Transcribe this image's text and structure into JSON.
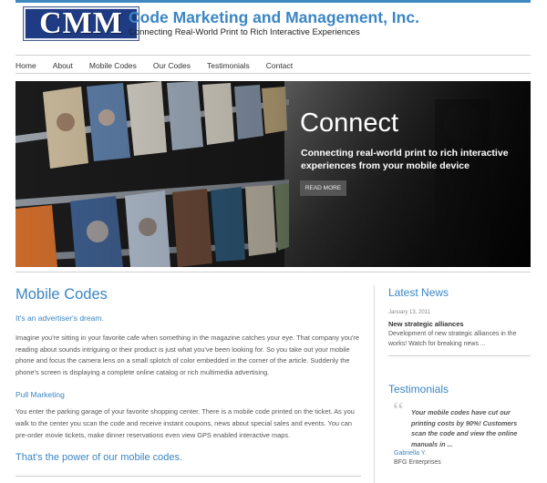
{
  "header": {
    "logo_text": "CMM",
    "title": "Code Marketing and Management, Inc.",
    "tagline": "Connecting Real-World Print to Rich Interactive Experiences"
  },
  "nav": {
    "items": [
      "Home",
      "About",
      "Mobile Codes",
      "Our Codes",
      "Testimonials",
      "Contact"
    ]
  },
  "slide": {
    "title": "Connect",
    "subtitle": "Connecting real-world print to rich interactive experiences from your mobile device",
    "button": "READ MORE"
  },
  "main": {
    "heading": "Mobile Codes",
    "lead": "It's an advertiser's dream.",
    "para1": "Imagine you're sitting in your favorite cafe when something in the magazine catches your eye. That company you're reading about sounds intriguing or their product is just what you've been looking for. So you take out your mobile phone and focus the camera lens on a small splotch of color embedded in the corner of the article. Suddenly the phone's screen is displaying a complete online catalog or rich multimedia advertising.",
    "subheading": "Pull Marketing",
    "para2": "You enter the parking garage of your favorite shopping center. There is a mobile code printed on the ticket. As you walk to the center you scan the code and receive instant coupons, news about special sales and events. You can pre-order movie tickets, make dinner reservations even view GPS enabled interactive maps.",
    "closing": "That's the power of our mobile codes."
  },
  "news": {
    "heading": "Latest News",
    "date": "January 13, 2011",
    "title": "New strategic alliances",
    "text": "Development of new strategic alliances in the works! Watch for breaking news ..."
  },
  "testimonials": {
    "heading": "Testimonials",
    "quote": "Your mobile codes have cut our printing costs by 90%! Customers scan the code and view the online manuals in ...",
    "author": "Gabriella Y.",
    "company": "BFG Enterprises"
  },
  "colors": {
    "accent": "#3b86c3",
    "logo_bg": "#1f3b84",
    "slider_bg": "#1a1a1a"
  }
}
